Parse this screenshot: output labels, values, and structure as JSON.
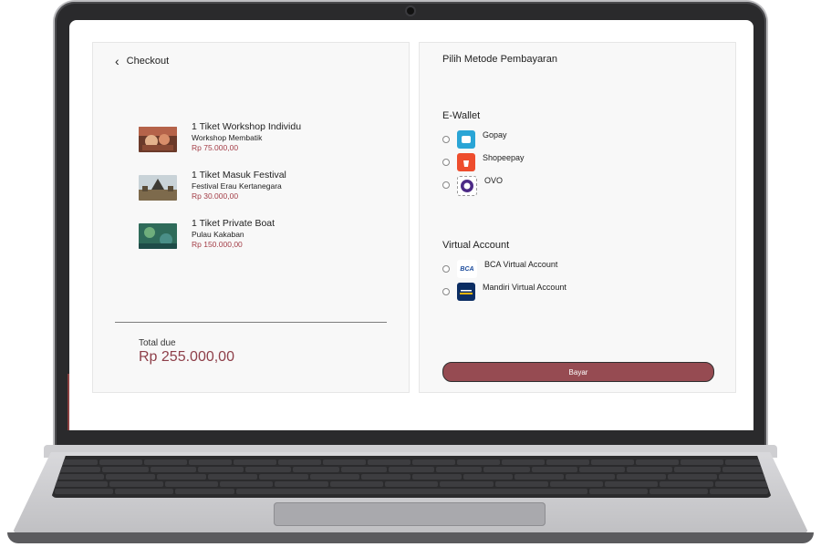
{
  "checkout": {
    "title": "Checkout",
    "tickets": [
      {
        "title": "1 Tiket Workshop Individu",
        "subtitle": "Workshop Membatik",
        "price": "Rp 75.000,00"
      },
      {
        "title": "1 Tiket Masuk Festival",
        "subtitle": "Festival Erau Kertanegara",
        "price": "Rp 30.000,00"
      },
      {
        "title": "1 Tiket Private Boat",
        "subtitle": "Pulau Kakaban",
        "price": "Rp 150.000,00"
      }
    ],
    "total_label": "Total due",
    "total_value": "Rp 255.000,00"
  },
  "payment": {
    "title": "Pilih Metode Pembayaran",
    "ewallet_title": "E-Wallet",
    "ewallet": [
      {
        "label": "Gopay",
        "icon": "gopay-logo-icon"
      },
      {
        "label": "Shopeepay",
        "icon": "shopeepay-logo-icon"
      },
      {
        "label": "OVO",
        "icon": "ovo-logo-icon"
      }
    ],
    "va_title": "Virtual Account",
    "virtual_accounts": [
      {
        "label": "BCA Virtual Account",
        "icon": "bca-logo-icon",
        "logo_text": "BCA"
      },
      {
        "label": "Mandiri Virtual Account",
        "icon": "mandiri-logo-icon"
      }
    ],
    "pay_button": "Bayar"
  },
  "colors": {
    "accent": "#964b52",
    "price": "#a33d47",
    "total": "#8e3f49"
  }
}
